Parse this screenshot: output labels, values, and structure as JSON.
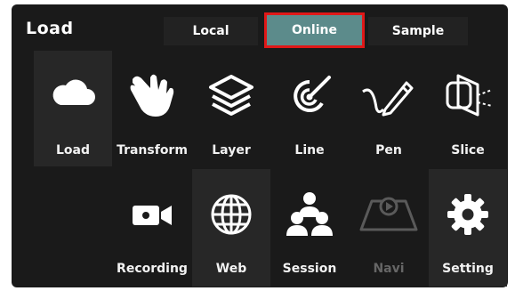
{
  "header": {
    "title": "Load"
  },
  "tabs": [
    {
      "label": "Local"
    },
    {
      "label": "Online"
    },
    {
      "label": "Sample"
    }
  ],
  "tools": {
    "load": "Load",
    "transform": "Transform",
    "layer": "Layer",
    "line": "Line",
    "pen": "Pen",
    "slice": "Slice",
    "recording": "Recording",
    "web": "Web",
    "session": "Session",
    "navi": "Navi",
    "setting": "Setting"
  },
  "colors": {
    "selected_tab": "#5c8b8b",
    "selected_tab_border": "#e01818",
    "panel": "#1a1a1a",
    "highlight_tile": "#272727",
    "disabled_text": "#666666"
  },
  "icons": {
    "load": "cloud-icon",
    "transform": "hand-icon",
    "layer": "layers-icon",
    "line": "target-line-icon",
    "pen": "pen-icon",
    "slice": "slice-icon",
    "recording": "camera-icon",
    "web": "globe-icon",
    "session": "users-icon",
    "navi": "navigation-icon",
    "setting": "gear-icon"
  }
}
